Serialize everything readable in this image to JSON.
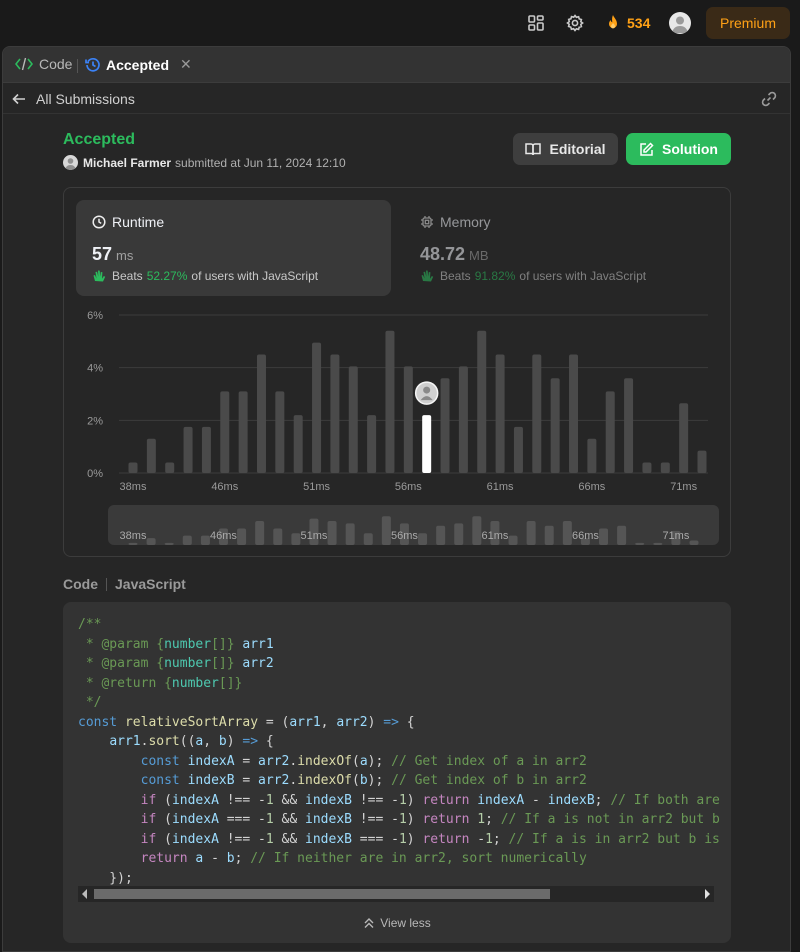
{
  "topbar": {
    "icons": [
      "grid-layout-icon",
      "gear-icon"
    ],
    "streak_count": "534",
    "premium_label": "Premium"
  },
  "tabs": {
    "code_label": "Code",
    "accepted_label": "Accepted",
    "close_glyph": "✕"
  },
  "subbar": {
    "back_label": "All Submissions"
  },
  "submission": {
    "status": "Accepted",
    "user": "Michael Farmer",
    "submitted_text": "submitted at Jun 11, 2024 12:10",
    "editorial_label": "Editorial",
    "solution_label": "Solution"
  },
  "runtime": {
    "title": "Runtime",
    "value": "57",
    "unit": "ms",
    "beats_label": "Beats",
    "beats_pct": "52.27%",
    "beats_suffix": "of users with JavaScript"
  },
  "memory": {
    "title": "Memory",
    "value": "48.72",
    "unit": "MB",
    "beats_label": "Beats",
    "beats_pct": "91.82%",
    "beats_suffix": "of users with JavaScript"
  },
  "chart_data": {
    "type": "bar",
    "title": "",
    "xlabel": "",
    "ylabel": "",
    "ylim": [
      0,
      6
    ],
    "y_ticks": [
      "0%",
      "2%",
      "4%",
      "6%"
    ],
    "x_ticks": [
      "38ms",
      "46ms",
      "51ms",
      "56ms",
      "61ms",
      "66ms",
      "71ms"
    ],
    "grid": true,
    "highlight_index": 16,
    "values": [
      0.4,
      1.3,
      0.4,
      1.75,
      1.75,
      3.1,
      3.1,
      4.5,
      3.1,
      2.2,
      4.95,
      4.5,
      4.05,
      2.2,
      5.4,
      4.05,
      2.2,
      3.6,
      4.05,
      5.4,
      4.5,
      1.75,
      4.5,
      3.6,
      4.5,
      1.3,
      3.1,
      3.6,
      0.4,
      0.4,
      2.65,
      0.85
    ]
  },
  "code_section": {
    "label": "Code",
    "language": "JavaScript",
    "view_less_label": "View less"
  },
  "colors": {
    "accepted_green": "#2cbb5d",
    "premium_orange": "#ffa116",
    "bar_gray": "#4a4a4a",
    "bar_highlight": "#ffffff"
  }
}
